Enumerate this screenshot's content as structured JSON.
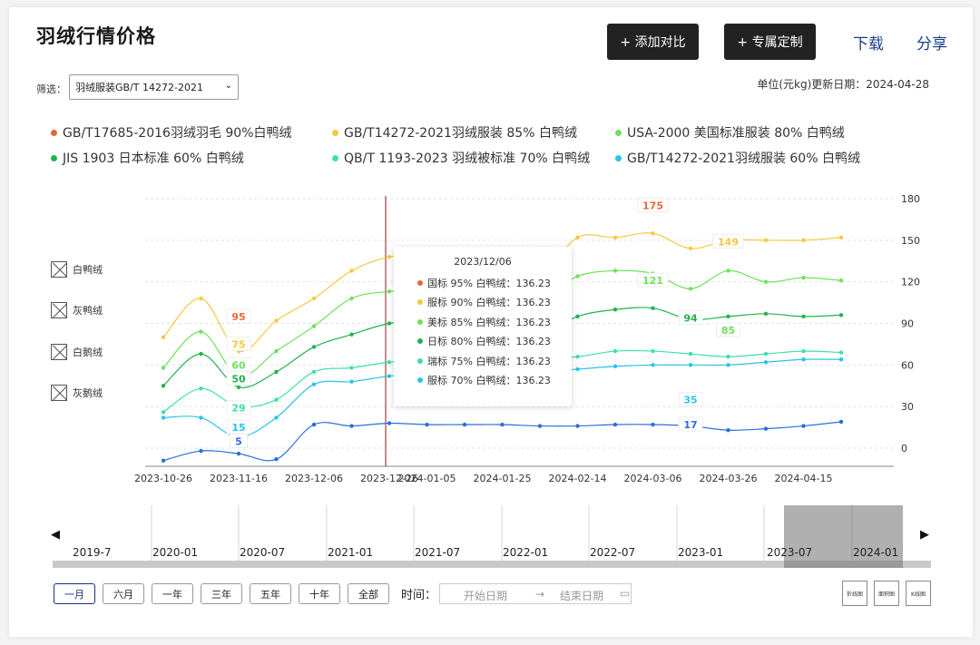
{
  "header": {
    "title": "羽绒行情价格",
    "compare_label": "+ 添加对比",
    "custom_label": "+ 专属定制",
    "download_label": "下载",
    "share_label": "分享"
  },
  "filter": {
    "label": "筛选：",
    "selected": "羽绒服装GB/T 14272-2021",
    "chevron": "⌄"
  },
  "unit_date": "单位(元kg)更新日期：2024-04-28",
  "side_filters": [
    "白鸭绒",
    "灰鸭绒",
    "白鹅绒",
    "灰鹅绒"
  ],
  "tooltip": {
    "title": "2023/12/06",
    "rows": [
      {
        "text": "国标 95% 白鸭绒：136.23",
        "color": "#e8663a"
      },
      {
        "text": "服标 90% 白鸭绒：136.23",
        "color": "#f5c842"
      },
      {
        "text": "美标 85% 白鸭绒：136.23",
        "color": "#6fe05a"
      },
      {
        "text": "日标 80% 白鸭绒：136.23",
        "color": "#22b24c"
      },
      {
        "text": "瑞标 75% 白鸭绒：136.23",
        "color": "#3de0a8"
      },
      {
        "text": "服标 70% 白鸭绒：136.23",
        "color": "#29c4e8"
      }
    ]
  },
  "timeline": {
    "left_arrow": "◀",
    "right_arrow": "▶",
    "labels": [
      "2019-7",
      "2020-01",
      "2020-07",
      "2021-01",
      "2021-07",
      "2022-01",
      "2022-07",
      "2023-01",
      "2023-07",
      "2024-01"
    ]
  },
  "range_buttons": [
    "一月",
    "六月",
    "一年",
    "三年",
    "五年",
    "十年",
    "全部"
  ],
  "time": {
    "label": "时间：",
    "start_placeholder": "开始日期",
    "arrow": "→",
    "end_placeholder": "结束日期",
    "calendar_icon": "▭"
  },
  "chart_types": [
    "折线图",
    "面积图",
    "K线图"
  ],
  "chart_data": {
    "type": "line",
    "x": [
      "2023-10-26",
      "2023-11-05",
      "2023-11-16",
      "2023-11-26",
      "2023-12-06",
      "2023-12-16",
      "2023-12-26",
      "2024-01-05",
      "2024-01-15",
      "2024-01-25",
      "2024-02-04",
      "2024-02-14",
      "2024-02-24",
      "2024-03-06",
      "2024-03-16",
      "2024-03-26",
      "2024-04-05",
      "2024-04-15",
      "2024-04-25"
    ],
    "x_tick_labels": [
      "2023-10-26",
      "2023-11-16",
      "2023-12-06",
      "2023-12-26",
      "2024-01-05",
      "2024-01-25",
      "2024-02-14",
      "2024-03-06",
      "2024-03-26",
      "2024-04-15"
    ],
    "y_ticks": [
      0,
      30,
      60,
      90,
      120,
      150,
      180
    ],
    "ylim": [
      -10,
      180
    ],
    "hover_date": "2023-12-26",
    "series": [
      {
        "name": "GB/T17685-2016羽绒羽毛  90%白鸭绒",
        "color": "#e8663a",
        "values": [
          null,
          null,
          null,
          null,
          null,
          null,
          null,
          null,
          null,
          null,
          null,
          null,
          null,
          null,
          null,
          null,
          null,
          null,
          null
        ],
        "labels": [
          {
            "index": 2,
            "text": "95",
            "value": 95
          },
          {
            "index": 13,
            "text": "175",
            "value": 175
          }
        ]
      },
      {
        "name": "GB/T14272-2021羽绒服装 85% 白鸭绒",
        "color": "#f5c842",
        "values": [
          80,
          108,
          70,
          92,
          108,
          128,
          138,
          140,
          140,
          128,
          124,
          152,
          152,
          155,
          144,
          150,
          150,
          150,
          152
        ],
        "labels": [
          {
            "index": 2,
            "text": "75",
            "value": 75
          },
          {
            "index": 15,
            "text": "149",
            "value": 149
          }
        ]
      },
      {
        "name": "USA-2000 美国标准服装 80% 白鸭绒",
        "color": "#6fe05a",
        "values": [
          58,
          84,
          52,
          70,
          88,
          108,
          113,
          114,
          112,
          110,
          108,
          124,
          128,
          126,
          115,
          128,
          120,
          123,
          121
        ],
        "labels": [
          {
            "index": 2,
            "text": "60",
            "value": 60
          },
          {
            "index": 13,
            "text": "121",
            "value": 121
          },
          {
            "index": 15,
            "text": "85",
            "value": 85
          }
        ]
      },
      {
        "name": "JIS 1903 日本标准 60% 白鸭绒",
        "color": "#22b24c",
        "values": [
          45,
          68,
          44,
          55,
          73,
          82,
          90,
          92,
          88,
          84,
          82,
          95,
          100,
          101,
          93,
          95,
          97,
          95,
          96
        ],
        "labels": [
          {
            "index": 2,
            "text": "50",
            "value": 50
          },
          {
            "index": 14,
            "text": "94",
            "value": 94
          }
        ]
      },
      {
        "name": "QB/T 1193-2023 羽绒被标准 70% 白鸭绒",
        "color": "#3de0a8",
        "values": [
          26,
          43,
          30,
          35,
          55,
          58,
          62,
          64,
          64,
          64,
          65,
          66,
          70,
          70,
          68,
          66,
          68,
          70,
          69
        ],
        "labels": [
          {
            "index": 2,
            "text": "29",
            "value": 29
          }
        ]
      },
      {
        "name": "GB/T14272-2021羽绒服装 60% 白鸭绒",
        "color": "#29c4e8",
        "values": [
          22,
          22,
          8,
          22,
          46,
          48,
          52,
          54,
          54,
          55,
          55,
          57,
          59,
          60,
          60,
          60,
          62,
          64,
          64
        ],
        "labels": [
          {
            "index": 2,
            "text": "15",
            "value": 15
          },
          {
            "index": 14,
            "text": "35",
            "value": 35
          }
        ]
      },
      {
        "name": "",
        "color": "#2a6edb",
        "values": [
          -9,
          -2,
          -4,
          -8,
          17,
          16,
          18,
          17,
          17,
          17,
          16,
          16,
          17,
          17,
          16,
          13,
          14,
          16,
          19
        ],
        "labels": [
          {
            "index": 2,
            "text": "5",
            "value": 5
          },
          {
            "index": 14,
            "text": "17",
            "value": 17
          }
        ]
      }
    ]
  }
}
